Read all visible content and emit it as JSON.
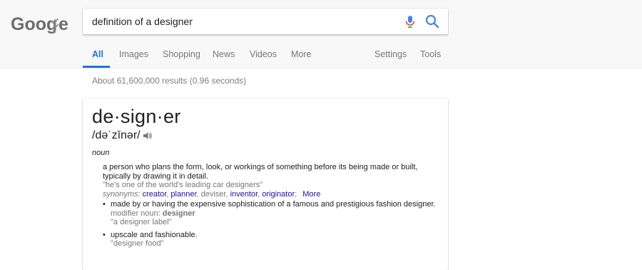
{
  "header": {
    "logo_text": "Google",
    "search": {
      "value": "definition of a designer"
    }
  },
  "tabs": [
    {
      "label": "All",
      "active": true
    },
    {
      "label": "Images"
    },
    {
      "label": "Shopping"
    },
    {
      "label": "News"
    },
    {
      "label": "Videos"
    },
    {
      "label": "More"
    },
    {
      "label": "Settings"
    },
    {
      "label": "Tools"
    }
  ],
  "results_stats": "About 61,600,000 results (0.96 seconds)",
  "dictionary": {
    "word": "de·sign·er",
    "pronunciation": "/dəˈzīnər/",
    "part_of_speech": "noun",
    "definitions": [
      {
        "text": "a person who plans the form, look, or workings of something before its being made or built, typically by drawing it in detail.",
        "example": "\"he's one of the world's leading car designers\"",
        "synonyms_label": "synonyms:",
        "synonyms": [
          "creator",
          "planner",
          "deviser",
          "inventor",
          "originator"
        ],
        "more_label": "More"
      }
    ],
    "adjective_senses": [
      {
        "text": "made by or having the expensive sophistication of a famous and prestigious fashion designer.",
        "modifier_label": "modifier noun:",
        "modifier_word": "designer",
        "example": "\"a designer label\""
      },
      {
        "text": "upscale and fashionable.",
        "example": "\"designer food\""
      }
    ]
  },
  "colors": {
    "accent_blue": "#1a73e8",
    "link": "#1a0dab",
    "muted": "#777777"
  },
  "icons": [
    "mic-icon",
    "search-icon",
    "speaker-icon"
  ]
}
